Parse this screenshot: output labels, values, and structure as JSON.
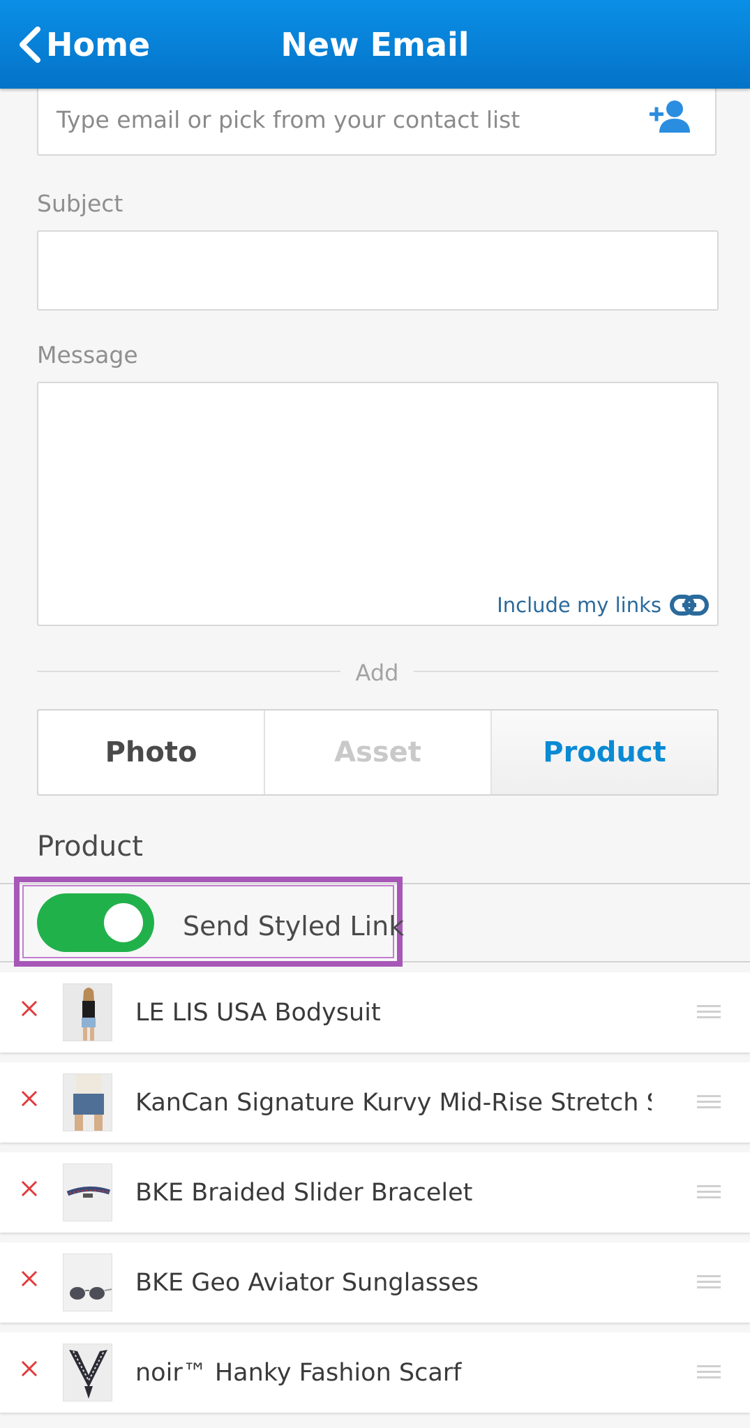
{
  "header": {
    "back_label": "Home",
    "title": "New Email"
  },
  "to": {
    "placeholder": "Type email or pick from your contact list",
    "add_contact_icon": "add-person-icon"
  },
  "subject": {
    "label": "Subject",
    "value": ""
  },
  "message": {
    "label": "Message",
    "value": "",
    "include_links_label": "Include my links",
    "link_icon": "link-icon"
  },
  "add_divider": "Add",
  "tabs": [
    {
      "label": "Photo",
      "state": "normal"
    },
    {
      "label": "Asset",
      "state": "disabled"
    },
    {
      "label": "Product",
      "state": "selected"
    }
  ],
  "product_section": {
    "title": "Product",
    "styled_link_label": "Send Styled Link",
    "styled_link_on": true
  },
  "products": [
    {
      "name": "LE LIS USA Bodysuit"
    },
    {
      "name": "KanCan Signature Kurvy Mid-Rise Stretch Sh..."
    },
    {
      "name": "BKE Braided Slider Bracelet"
    },
    {
      "name": "BKE Geo Aviator Sunglasses"
    },
    {
      "name": "noir™ Hanky Fashion Scarf"
    }
  ],
  "colors": {
    "header_blue": "#0473c8",
    "accent_blue": "#0a8ad3",
    "toggle_green": "#21b14b",
    "remove_red": "#e03a3a",
    "highlight_purple": "#a757b7"
  }
}
